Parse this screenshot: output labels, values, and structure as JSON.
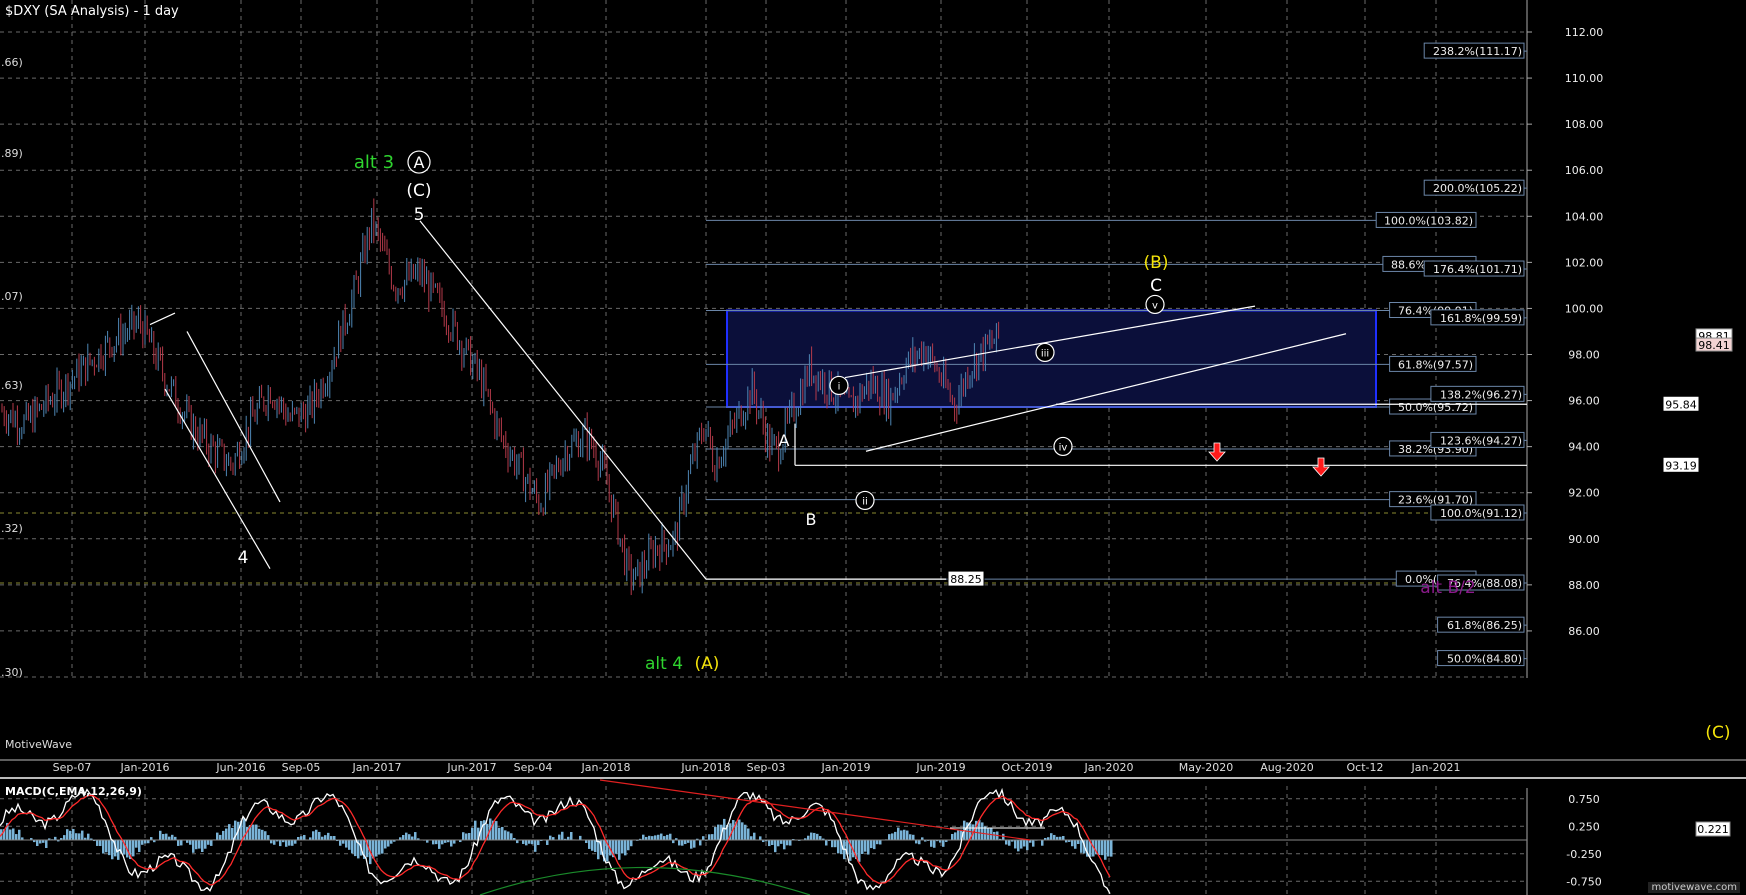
{
  "header": {
    "title": "$DXY (SA Analysis) - 1 day"
  },
  "watermark": "MotiveWave",
  "site": "motivewave.com",
  "macd": {
    "title": "MACD(C,EMA,12,26,9)",
    "value_label": "0.221",
    "y_ticks": [
      0.75,
      0.25,
      -0.25,
      -0.75
    ],
    "y_tick_labels": [
      "0.750",
      "0.250",
      "-0.250",
      "-0.750"
    ]
  },
  "colors": {
    "background": "#000000",
    "grid": "#6a6a6a",
    "bull_candle": "#4e86b4",
    "bear_candle": "#b43a4a",
    "wave_white": "#ffffff",
    "wave_green": "#2fd42f",
    "wave_yellow": "#f2e20a",
    "wave_purple": "#8b1a8b",
    "box_border": "#1f2fff",
    "box_fill": "#0b0f3a",
    "fib_line": "#6b86a8",
    "arrow": "#ff1a1a",
    "macd_line": "#ffffff",
    "signal_line": "#ff2a2a",
    "histogram": "#7ab4d8"
  },
  "left_edge_labels": [
    ".66)",
    ".89)",
    ".07)",
    ".63)",
    ".32)",
    ".30)"
  ],
  "chart_data": {
    "type": "candlestick",
    "title": "$DXY (SA Analysis) - 1 day",
    "x_ticks": [
      "Sep-07",
      "Jan-2016",
      "Jun-2016",
      "Sep-05",
      "Jan-2017",
      "Jun-2017",
      "Sep-04",
      "Jan-2018",
      "Jun-2018",
      "Sep-03",
      "Jan-2019",
      "Jun-2019",
      "Oct-2019",
      "Jan-2020",
      "May-2020",
      "Aug-2020",
      "Oct-12",
      "Jan-2021"
    ],
    "y_ticks": [
      84,
      86,
      88,
      90,
      92,
      94,
      96,
      98,
      100,
      102,
      104,
      106,
      108,
      110,
      112
    ],
    "y_tick_labels": [
      "84.00",
      "86.00",
      "88.00",
      "90.00",
      "92.00",
      "94.00",
      "96.00",
      "98.00",
      "100.00",
      "102.00",
      "104.00",
      "106.00",
      "108.00",
      "110.00",
      "112.00"
    ],
    "ylim": [
      84.4,
      113
    ],
    "price_path": [
      [
        "Sep-07",
        95.6
      ],
      [
        "Oct-2015",
        95.0
      ],
      [
        "Dec-2015",
        98.5
      ],
      [
        "Jan-2016",
        99.4
      ],
      [
        "Feb-2016",
        97.0
      ],
      [
        "Mar-2016",
        95.0
      ],
      [
        "Apr-2016",
        94.0
      ],
      [
        "May-2016",
        93.2
      ],
      [
        "Jun-2016",
        95.0
      ],
      [
        "Jul-2016",
        96.5
      ],
      [
        "Aug-2016",
        95.2
      ],
      [
        "Sep-05",
        95.6
      ],
      [
        "Oct-2016",
        97.5
      ],
      [
        "Nov-2016",
        100.8
      ],
      [
        "Jan-2017",
        103.8
      ],
      [
        "Feb-2017",
        101.0
      ],
      [
        "Mar-2017",
        101.5
      ],
      [
        "Apr-2017",
        99.8
      ],
      [
        "Jun-2017",
        97.0
      ],
      [
        "Jul-2017",
        94.5
      ],
      [
        "Aug-2017",
        93.0
      ],
      [
        "Sep-04",
        91.5
      ],
      [
        "Oct-2017",
        93.8
      ],
      [
        "Nov-2017",
        94.5
      ],
      [
        "Dec-2017",
        93.5
      ],
      [
        "Jan-2018",
        91.0
      ],
      [
        "Feb-2018",
        88.5
      ],
      [
        "Feb-2018b",
        88.25
      ],
      [
        "Mar-2018",
        89.6
      ],
      [
        "Apr-2018",
        90.0
      ],
      [
        "May-2018",
        93.0
      ],
      [
        "Jun-2018",
        95.0
      ],
      [
        "Jun-2018b",
        93.2
      ],
      [
        "Aug-2018",
        96.5
      ],
      [
        "Sep-03",
        94.0
      ],
      [
        "Sep-2018b",
        93.9
      ],
      [
        "Nov-2018",
        97.4
      ],
      [
        "Jan-2019",
        95.7
      ],
      [
        "Feb-2019",
        96.8
      ],
      [
        "Mar-2019",
        96.0
      ],
      [
        "Apr-2019",
        97.5
      ],
      [
        "May-2019",
        98.3
      ],
      [
        "Jun-2019",
        95.8
      ],
      [
        "Jul-2019",
        97.5
      ],
      [
        "Aug-2019",
        98.2
      ],
      [
        "Sep-2019",
        98.8
      ]
    ],
    "fib_levels_mid": [
      {
        "label": "100.0%(103.82)",
        "value": 103.82
      },
      {
        "label": "88.6%(101.91)",
        "value": 101.91
      },
      {
        "label": "76.4%(99.91)",
        "value": 99.91
      },
      {
        "label": "61.8%(97.57)",
        "value": 97.57
      },
      {
        "label": "50.0%(95.72)",
        "value": 95.72
      },
      {
        "label": "38.2%(93.90)",
        "value": 93.9
      },
      {
        "label": "23.6%(91.70)",
        "value": 91.7
      },
      {
        "label": "0.0%(88.25)",
        "value": 88.25
      }
    ],
    "fib_levels_right": [
      {
        "label": "238.2%(111.17)",
        "value": 111.17
      },
      {
        "label": "200.0%(105.22)",
        "value": 105.22
      },
      {
        "label": "176.4%(101.71)",
        "value": 101.71
      },
      {
        "label": "161.8%(99.59)",
        "value": 99.59
      },
      {
        "label": "138.2%(96.27)",
        "value": 96.27
      },
      {
        "label": "123.6%(94.27)",
        "value": 94.27
      },
      {
        "label": "100.0%(91.12)",
        "value": 91.12
      },
      {
        "label": "76.4%(88.08)",
        "value": 88.08
      },
      {
        "label": "61.8%(86.25)",
        "value": 86.25
      },
      {
        "label": "50.0%(84.80)",
        "value": 84.8
      }
    ],
    "price_boxes": [
      {
        "label": "88.25",
        "value": 88.25
      },
      {
        "label": "93.19",
        "value": 93.19
      },
      {
        "label": "95.84",
        "value": 95.84
      }
    ],
    "axis_price_tags": [
      {
        "label": "98.81",
        "value": 98.81
      },
      {
        "label": "98.41",
        "value": 98.41
      }
    ],
    "wave_labels": [
      {
        "text": "alt 3",
        "color": "green"
      },
      {
        "text": "A",
        "color": "white",
        "circled": true
      },
      {
        "text": "(C)",
        "color": "white"
      },
      {
        "text": "5",
        "color": "white"
      },
      {
        "text": "4",
        "color": "white"
      },
      {
        "text": "A",
        "color": "white"
      },
      {
        "text": "B",
        "color": "white"
      },
      {
        "text": "i",
        "color": "white",
        "circled": true
      },
      {
        "text": "ii",
        "color": "white",
        "circled": true
      },
      {
        "text": "iii",
        "color": "white",
        "circled": true
      },
      {
        "text": "iv",
        "color": "white",
        "circled": true
      },
      {
        "text": "v",
        "color": "white",
        "circled": true
      },
      {
        "text": "(B)",
        "color": "yellow"
      },
      {
        "text": "C",
        "color": "white"
      },
      {
        "text": "alt 4",
        "color": "green"
      },
      {
        "text": "(A)",
        "color": "yellow"
      },
      {
        "text": "alt B/2",
        "color": "purple"
      },
      {
        "text": "(C)",
        "color": "yellow"
      }
    ]
  }
}
